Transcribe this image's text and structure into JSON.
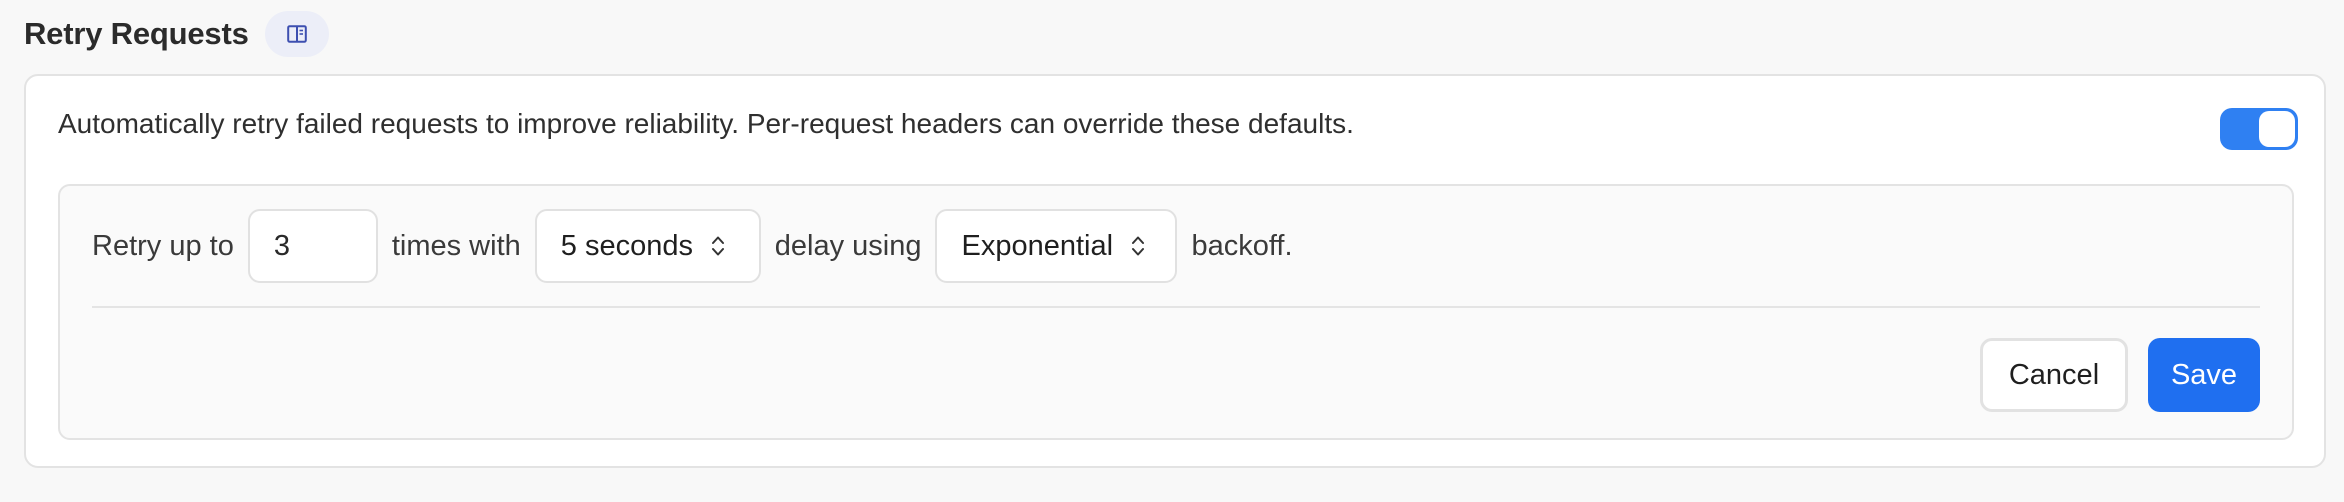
{
  "header": {
    "title": "Retry Requests",
    "doc_icon": "book-icon"
  },
  "card": {
    "description": "Automatically retry failed requests to improve reliability. Per-request headers can override these defaults.",
    "enabled": true,
    "toggle_color": "#2f80f2"
  },
  "config": {
    "prefix": "Retry up to",
    "attempts": "3",
    "times_label": "times with",
    "delay": "5 seconds",
    "delay_label": "delay using",
    "strategy": "Exponential",
    "suffix": "backoff."
  },
  "actions": {
    "cancel_label": "Cancel",
    "save_label": "Save",
    "save_color": "#1f6ff0"
  }
}
